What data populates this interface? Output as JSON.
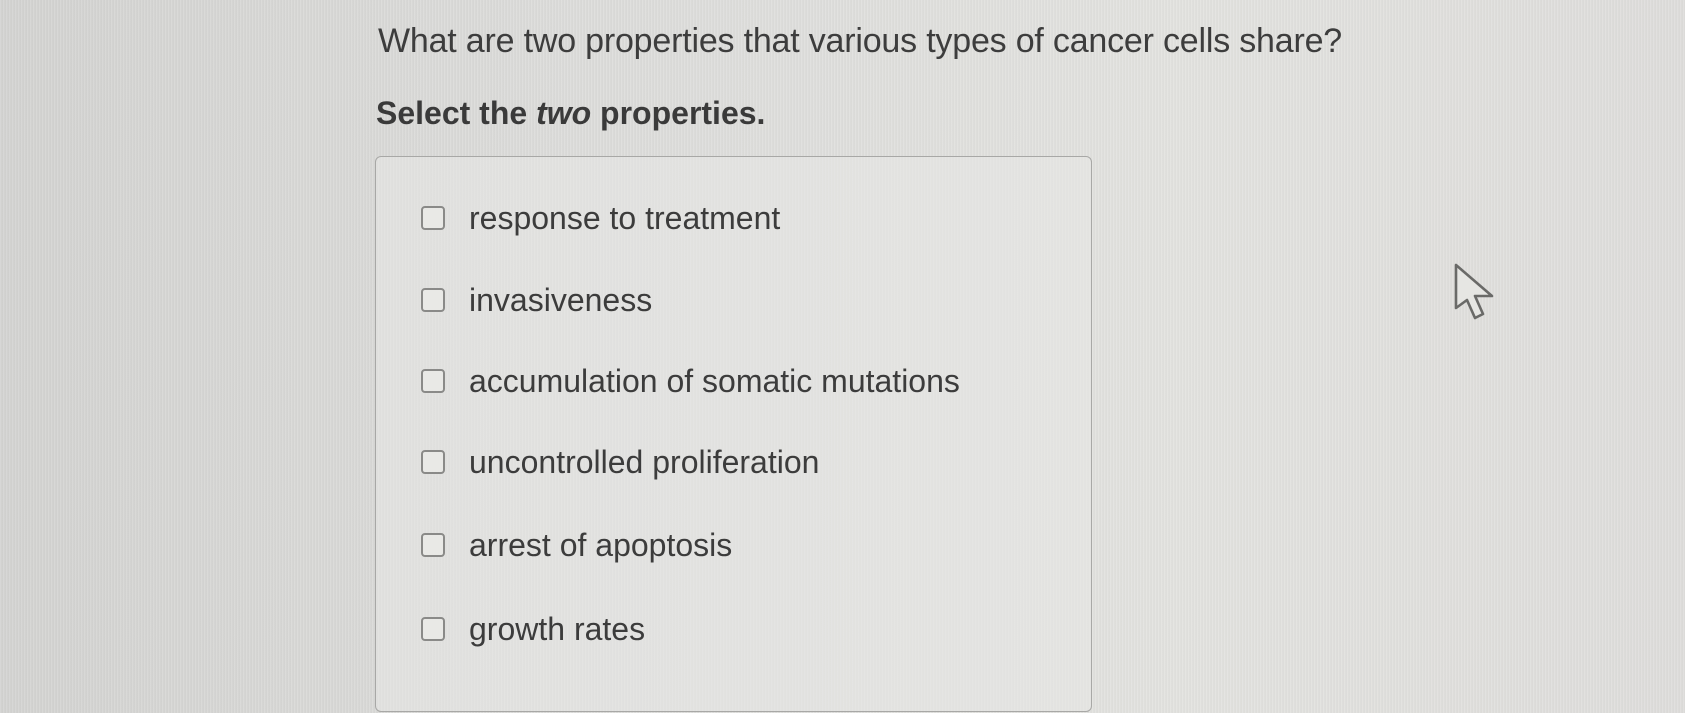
{
  "question": {
    "text": "What are two properties that various types of cancer cells share?"
  },
  "instruction": {
    "prefix": "Select the ",
    "emphasis": "two",
    "suffix": " properties."
  },
  "options": [
    {
      "label": "response to treatment",
      "checked": false
    },
    {
      "label": "invasiveness",
      "checked": false
    },
    {
      "label": "accumulation of somatic mutations",
      "checked": false
    },
    {
      "label": "uncontrolled proliferation",
      "checked": false
    },
    {
      "label": "arrest of apoptosis",
      "checked": false
    },
    {
      "label": "growth rates",
      "checked": false
    }
  ],
  "colors": {
    "background": "#dcdcda",
    "text": "#3d3d3d",
    "checkbox_border": "#8a8a88",
    "box_border": "#a8a8a6"
  },
  "icons": {
    "cursor": "mouse-pointer-icon"
  }
}
